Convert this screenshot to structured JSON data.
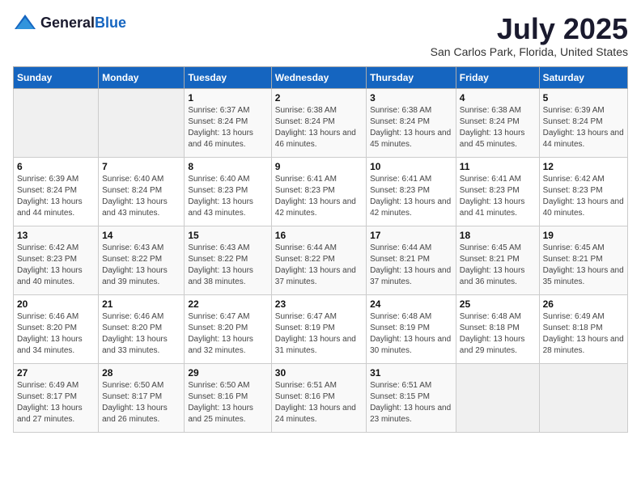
{
  "header": {
    "logo_general": "General",
    "logo_blue": "Blue",
    "title": "July 2025",
    "location": "San Carlos Park, Florida, United States"
  },
  "weekdays": [
    "Sunday",
    "Monday",
    "Tuesday",
    "Wednesday",
    "Thursday",
    "Friday",
    "Saturday"
  ],
  "weeks": [
    [
      {
        "day": "",
        "info": ""
      },
      {
        "day": "",
        "info": ""
      },
      {
        "day": "1",
        "info": "Sunrise: 6:37 AM\nSunset: 8:24 PM\nDaylight: 13 hours and 46 minutes."
      },
      {
        "day": "2",
        "info": "Sunrise: 6:38 AM\nSunset: 8:24 PM\nDaylight: 13 hours and 46 minutes."
      },
      {
        "day": "3",
        "info": "Sunrise: 6:38 AM\nSunset: 8:24 PM\nDaylight: 13 hours and 45 minutes."
      },
      {
        "day": "4",
        "info": "Sunrise: 6:38 AM\nSunset: 8:24 PM\nDaylight: 13 hours and 45 minutes."
      },
      {
        "day": "5",
        "info": "Sunrise: 6:39 AM\nSunset: 8:24 PM\nDaylight: 13 hours and 44 minutes."
      }
    ],
    [
      {
        "day": "6",
        "info": "Sunrise: 6:39 AM\nSunset: 8:24 PM\nDaylight: 13 hours and 44 minutes."
      },
      {
        "day": "7",
        "info": "Sunrise: 6:40 AM\nSunset: 8:24 PM\nDaylight: 13 hours and 43 minutes."
      },
      {
        "day": "8",
        "info": "Sunrise: 6:40 AM\nSunset: 8:23 PM\nDaylight: 13 hours and 43 minutes."
      },
      {
        "day": "9",
        "info": "Sunrise: 6:41 AM\nSunset: 8:23 PM\nDaylight: 13 hours and 42 minutes."
      },
      {
        "day": "10",
        "info": "Sunrise: 6:41 AM\nSunset: 8:23 PM\nDaylight: 13 hours and 42 minutes."
      },
      {
        "day": "11",
        "info": "Sunrise: 6:41 AM\nSunset: 8:23 PM\nDaylight: 13 hours and 41 minutes."
      },
      {
        "day": "12",
        "info": "Sunrise: 6:42 AM\nSunset: 8:23 PM\nDaylight: 13 hours and 40 minutes."
      }
    ],
    [
      {
        "day": "13",
        "info": "Sunrise: 6:42 AM\nSunset: 8:23 PM\nDaylight: 13 hours and 40 minutes."
      },
      {
        "day": "14",
        "info": "Sunrise: 6:43 AM\nSunset: 8:22 PM\nDaylight: 13 hours and 39 minutes."
      },
      {
        "day": "15",
        "info": "Sunrise: 6:43 AM\nSunset: 8:22 PM\nDaylight: 13 hours and 38 minutes."
      },
      {
        "day": "16",
        "info": "Sunrise: 6:44 AM\nSunset: 8:22 PM\nDaylight: 13 hours and 37 minutes."
      },
      {
        "day": "17",
        "info": "Sunrise: 6:44 AM\nSunset: 8:21 PM\nDaylight: 13 hours and 37 minutes."
      },
      {
        "day": "18",
        "info": "Sunrise: 6:45 AM\nSunset: 8:21 PM\nDaylight: 13 hours and 36 minutes."
      },
      {
        "day": "19",
        "info": "Sunrise: 6:45 AM\nSunset: 8:21 PM\nDaylight: 13 hours and 35 minutes."
      }
    ],
    [
      {
        "day": "20",
        "info": "Sunrise: 6:46 AM\nSunset: 8:20 PM\nDaylight: 13 hours and 34 minutes."
      },
      {
        "day": "21",
        "info": "Sunrise: 6:46 AM\nSunset: 8:20 PM\nDaylight: 13 hours and 33 minutes."
      },
      {
        "day": "22",
        "info": "Sunrise: 6:47 AM\nSunset: 8:20 PM\nDaylight: 13 hours and 32 minutes."
      },
      {
        "day": "23",
        "info": "Sunrise: 6:47 AM\nSunset: 8:19 PM\nDaylight: 13 hours and 31 minutes."
      },
      {
        "day": "24",
        "info": "Sunrise: 6:48 AM\nSunset: 8:19 PM\nDaylight: 13 hours and 30 minutes."
      },
      {
        "day": "25",
        "info": "Sunrise: 6:48 AM\nSunset: 8:18 PM\nDaylight: 13 hours and 29 minutes."
      },
      {
        "day": "26",
        "info": "Sunrise: 6:49 AM\nSunset: 8:18 PM\nDaylight: 13 hours and 28 minutes."
      }
    ],
    [
      {
        "day": "27",
        "info": "Sunrise: 6:49 AM\nSunset: 8:17 PM\nDaylight: 13 hours and 27 minutes."
      },
      {
        "day": "28",
        "info": "Sunrise: 6:50 AM\nSunset: 8:17 PM\nDaylight: 13 hours and 26 minutes."
      },
      {
        "day": "29",
        "info": "Sunrise: 6:50 AM\nSunset: 8:16 PM\nDaylight: 13 hours and 25 minutes."
      },
      {
        "day": "30",
        "info": "Sunrise: 6:51 AM\nSunset: 8:16 PM\nDaylight: 13 hours and 24 minutes."
      },
      {
        "day": "31",
        "info": "Sunrise: 6:51 AM\nSunset: 8:15 PM\nDaylight: 13 hours and 23 minutes."
      },
      {
        "day": "",
        "info": ""
      },
      {
        "day": "",
        "info": ""
      }
    ]
  ]
}
